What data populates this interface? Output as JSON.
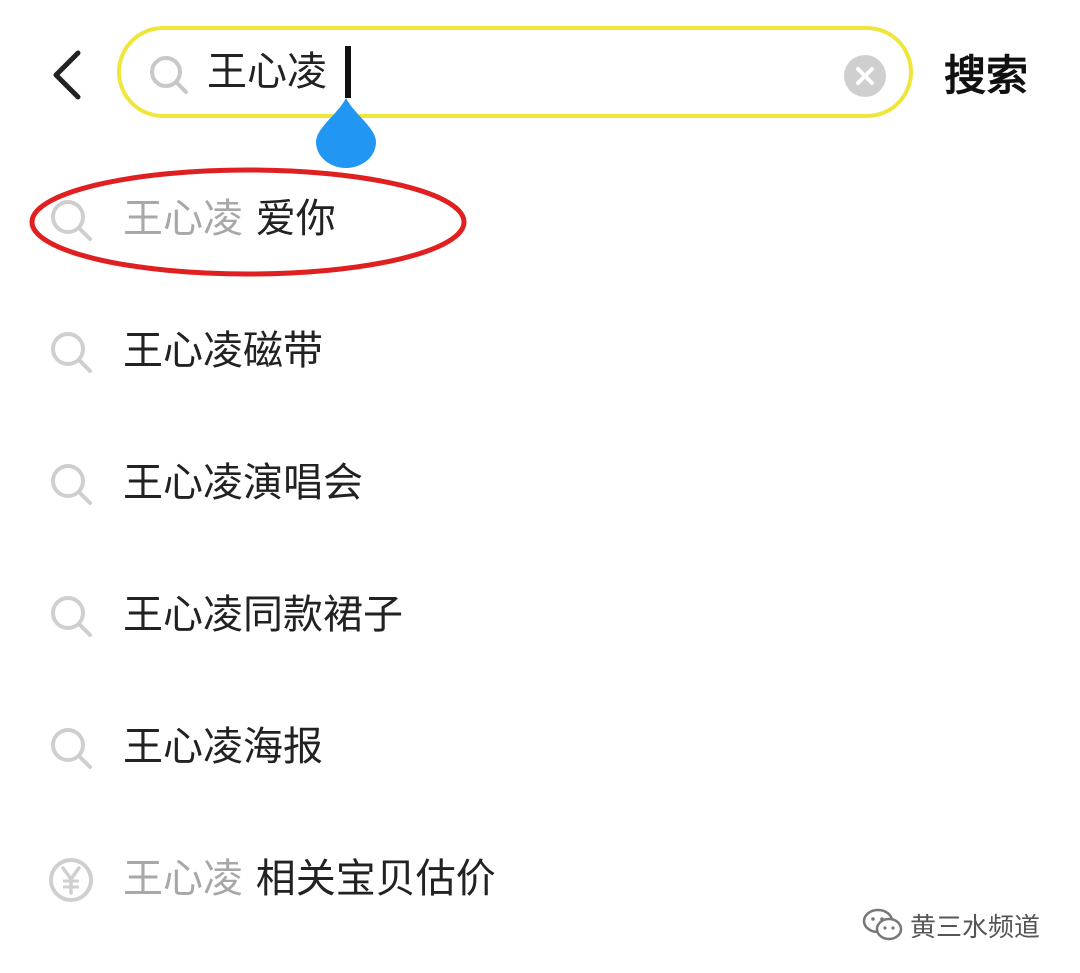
{
  "header": {
    "search_query": "王心凌",
    "search_button_label": "搜索"
  },
  "suggestions": [
    {
      "icon": "search-icon",
      "query_part": "王心凌",
      "rest": " 爱你",
      "split": true
    },
    {
      "icon": "search-icon",
      "text": "王心凌磁带"
    },
    {
      "icon": "search-icon",
      "text": "王心凌演唱会"
    },
    {
      "icon": "search-icon",
      "text": "王心凌同款裙子"
    },
    {
      "icon": "search-icon",
      "text": "王心凌海报"
    },
    {
      "icon": "yen-icon",
      "query_part": "王心凌",
      "rest": " 相关宝贝估价",
      "split": true
    }
  ],
  "watermark": {
    "text": "黄三水频道"
  },
  "colors": {
    "search_border": "#f0e53a",
    "drop_handle": "#2196f3",
    "highlight_ring": "#e02020",
    "icon_gray": "#c8c8c8"
  }
}
